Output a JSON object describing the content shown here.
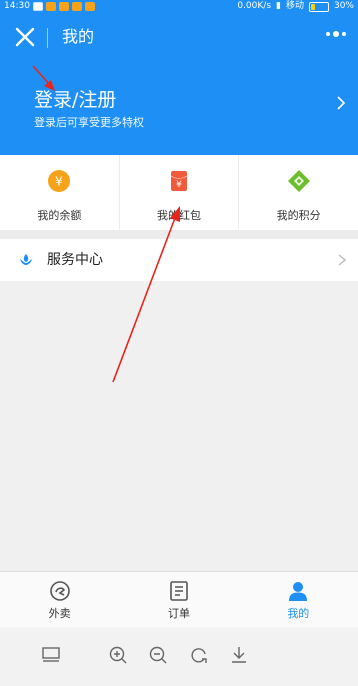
{
  "status_bar": {
    "time": "14:30",
    "network_speed": "0.00K/s",
    "carrier": "移动",
    "battery": "30%"
  },
  "header": {
    "title": "我的",
    "login_label": "登录/注册",
    "login_subtitle": "登录后可享受更多特权"
  },
  "wallet": [
    {
      "label": "我的余额",
      "icon": "coin-icon",
      "color": "#f7a21b"
    },
    {
      "label": "我的红包",
      "icon": "red-envelope-icon",
      "color": "#f15a3a"
    },
    {
      "label": "我的积分",
      "icon": "diamond-ticket-icon",
      "color": "#6cbf2a"
    }
  ],
  "service_center": {
    "label": "服务中心",
    "icon": "service-icon"
  },
  "tabs": [
    {
      "label": "外卖",
      "icon": "takeout-icon",
      "active": false
    },
    {
      "label": "订单",
      "icon": "order-list-icon",
      "active": false
    },
    {
      "label": "我的",
      "icon": "profile-icon",
      "active": true
    }
  ],
  "colors": {
    "brand_blue": "#1e90f5",
    "arrow_red": "#e8241c"
  }
}
